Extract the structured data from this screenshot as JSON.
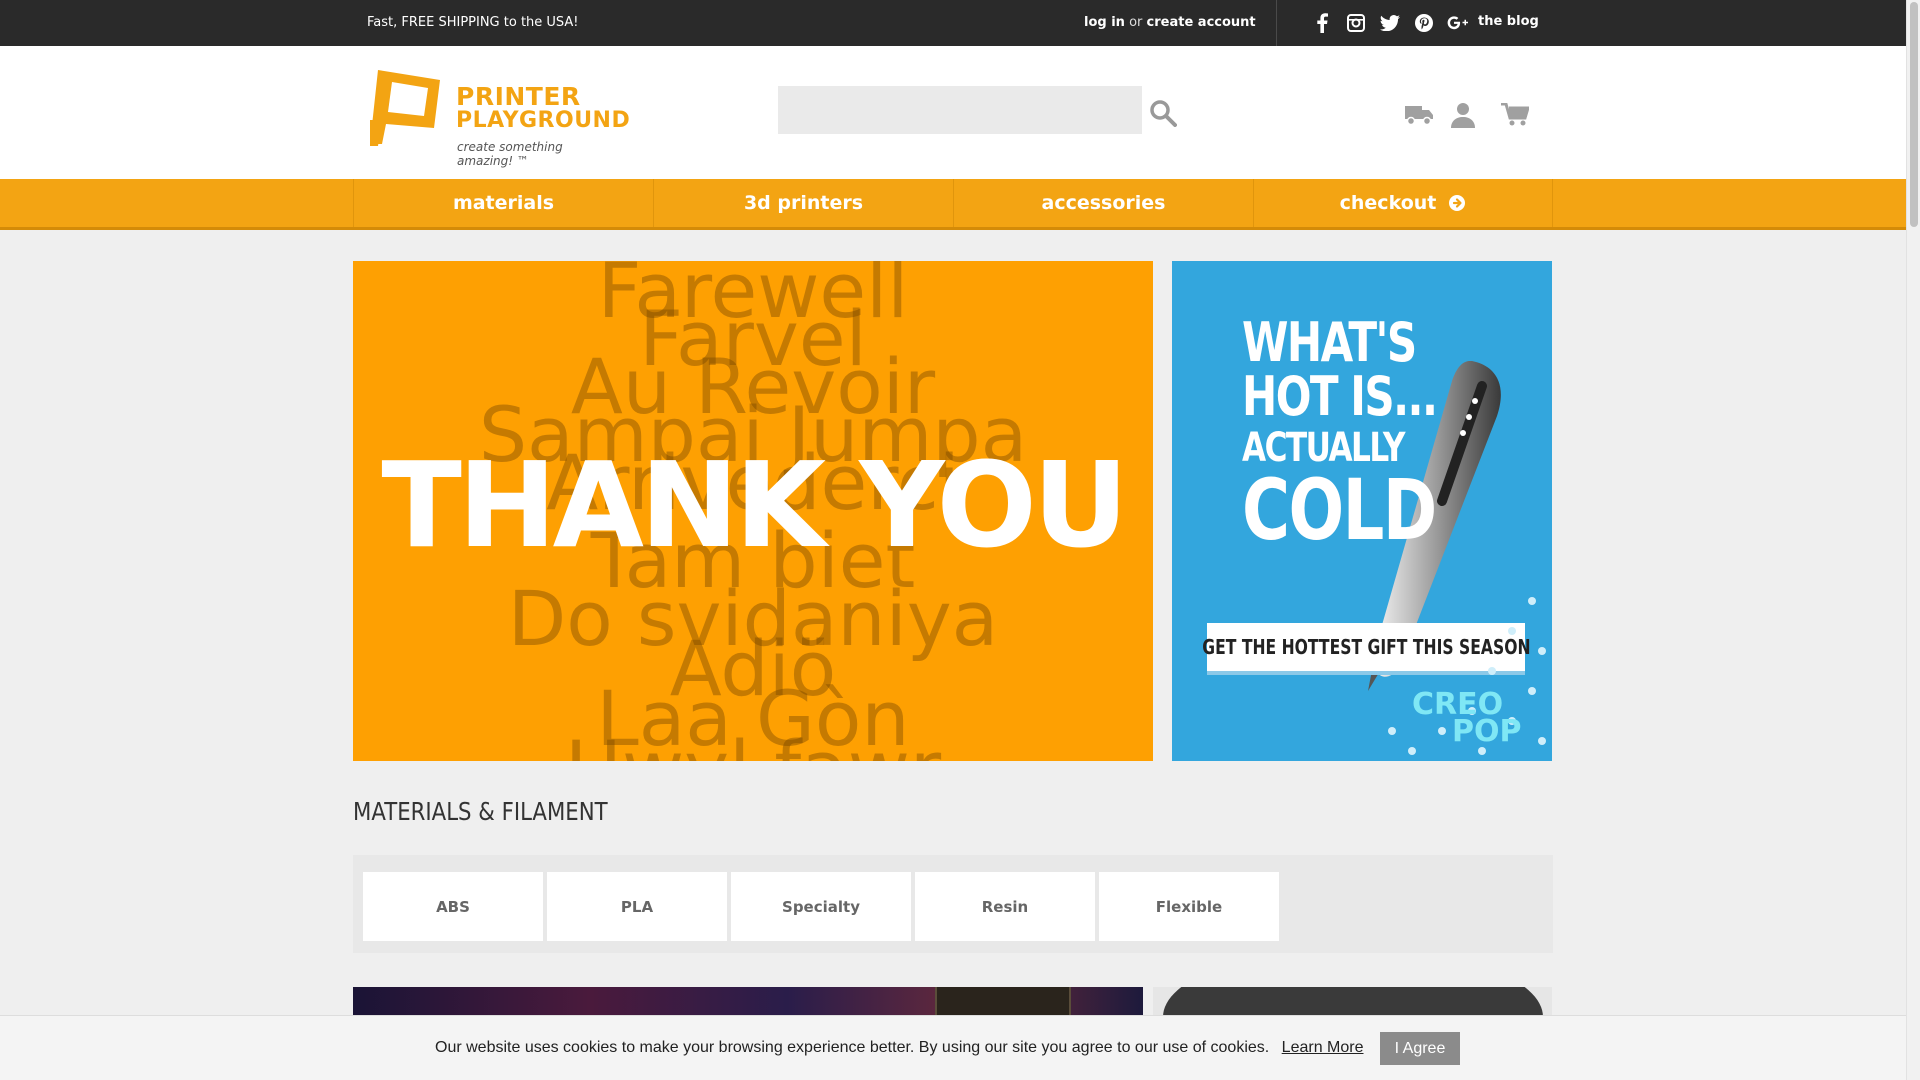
{
  "topbar": {
    "shipping": "Fast, FREE SHIPPING to the USA!",
    "login": "log in",
    "or": "or",
    "create": "create account",
    "blog": "the blog",
    "social": [
      "facebook-icon",
      "instagram-icon",
      "twitter-icon",
      "pinterest-icon",
      "google-plus-icon"
    ]
  },
  "header": {
    "logo_line1": "PRINTER",
    "logo_line2": "PLAYGROUND",
    "tagline": "create something amazing! ™",
    "search_value": "",
    "icons": [
      "truck-icon",
      "user-icon",
      "cart-icon"
    ]
  },
  "nav": {
    "items": [
      "materials",
      "3d printers",
      "accessories",
      "checkout"
    ]
  },
  "hero": {
    "words": [
      "Farewell",
      "Farvel",
      "Au Revoir",
      "Sampai Jumpa",
      "Arrivederci",
      "Tam biet",
      "Do svidaniya",
      "Adiö",
      "Laa Gòn",
      "Hwyl fawr"
    ],
    "main": "THANK YOU"
  },
  "promo": {
    "line1": "WHAT'S",
    "line2": "HOT IS...",
    "line3": "ACTUALLY",
    "line4": "COLD",
    "cta": "GET THE HOTTEST GIFT THIS SEASON",
    "brand1": "CREO",
    "brand2": "POP"
  },
  "materials": {
    "title": "MATERIALS & FILAMENT",
    "categories": [
      "ABS",
      "PLA",
      "Specialty",
      "Resin",
      "Flexible"
    ]
  },
  "cookie": {
    "message": "Our website uses cookies to make your browsing experience better. By using our site you agree to our use of cookies.",
    "learn_more": "Learn More",
    "agree": "I Agree"
  },
  "colors": {
    "accent": "#f3a413",
    "topbar": "#2a2a2a",
    "promo": "#33a6dd"
  }
}
